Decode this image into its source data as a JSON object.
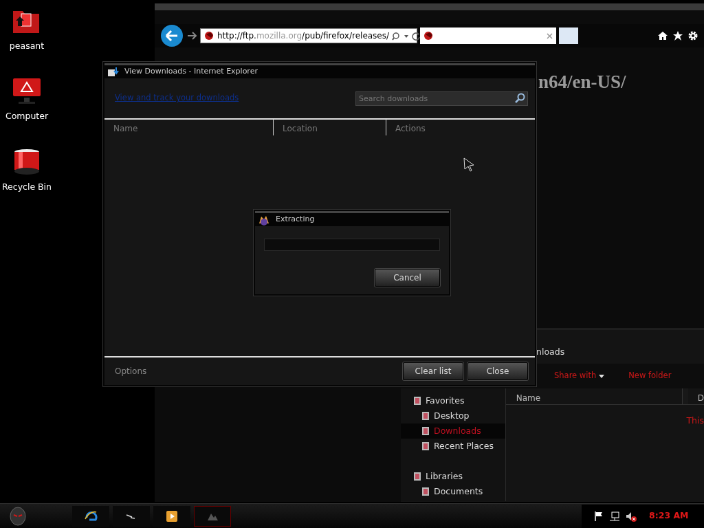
{
  "desktop_icons": [
    {
      "label": "peasant",
      "kind": "folder"
    },
    {
      "label": "Computer",
      "kind": "computer"
    },
    {
      "label": "Recycle Bin",
      "kind": "bin"
    }
  ],
  "browser": {
    "address": {
      "parts": [
        {
          "text": "http://ftp.",
          "dim": false
        },
        {
          "text": "mozilla.org",
          "dim": true
        },
        {
          "text": "/pub/firefox/releases/",
          "dim": false
        }
      ]
    },
    "page_heading": "n64/en-US/"
  },
  "explorer": {
    "title": "nloads",
    "toolbar": [
      {
        "label": "Share with",
        "has_menu": true
      },
      {
        "label": "New folder",
        "has_menu": false
      }
    ],
    "nav": [
      {
        "label": "Favorites",
        "selected": false,
        "children": [
          {
            "label": "Desktop",
            "selected": false
          },
          {
            "label": "Downloads",
            "selected": true
          },
          {
            "label": "Recent Places",
            "selected": false
          }
        ]
      },
      {
        "label": "Libraries",
        "selected": false,
        "children": [
          {
            "label": "Documents",
            "selected": false
          }
        ]
      }
    ],
    "columns": [
      "Name",
      "D"
    ],
    "message": "This"
  },
  "downloads_dialog": {
    "title": "View Downloads - Internet Explorer",
    "link": "View and track your downloads",
    "search": {
      "placeholder": "Search downloads"
    },
    "columns": [
      "Name",
      "Location",
      "Actions"
    ],
    "options": "Options",
    "buttons": [
      "Clear list",
      "Close"
    ]
  },
  "extract_dialog": {
    "title": "Extracting",
    "progress": {
      "level": 0
    },
    "button": "Cancel"
  },
  "taskbar": {
    "apps": [
      {
        "kind": "ie"
      },
      {
        "kind": "cmd"
      },
      {
        "kind": "media"
      },
      {
        "kind": "app"
      }
    ],
    "volume_muted": true,
    "clock": "8:23 AM"
  }
}
